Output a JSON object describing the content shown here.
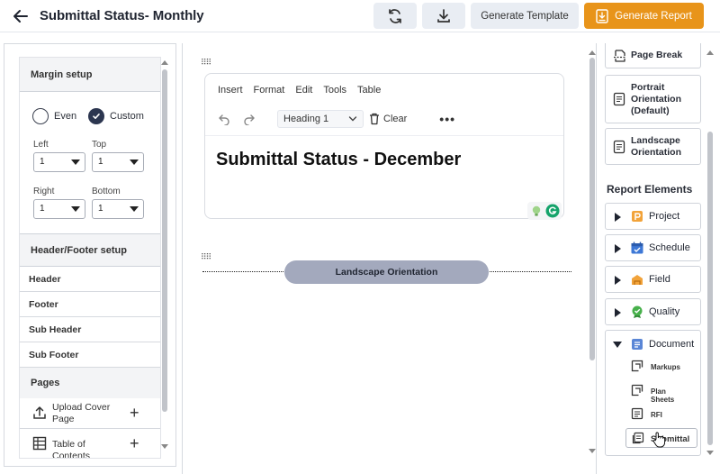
{
  "header": {
    "title": "Submittal Status- Monthly",
    "generate_template": "Generate Template",
    "generate_report": "Generate Report"
  },
  "left_panel": {
    "margin_setup": "Margin setup",
    "even": "Even",
    "custom": "Custom",
    "left_label": "Left",
    "top_label": "Top",
    "right_label": "Right",
    "bottom_label": "Bottom",
    "left_value": "1",
    "top_value": "1",
    "right_value": "1",
    "bottom_value": "1",
    "header_footer_setup": "Header/Footer setup",
    "header": "Header",
    "footer": "Footer",
    "sub_header": "Sub Header",
    "sub_footer": "Sub Footer",
    "pages": "Pages",
    "upload_cover_page": "Upload Cover Page",
    "table_of_contents": "Table of Contents"
  },
  "editor": {
    "menu": [
      "Insert",
      "Format",
      "Edit",
      "Tools",
      "Table"
    ],
    "heading_select": "Heading 1",
    "clear": "Clear",
    "more": "•••",
    "doc_title": "Submittal Status - December",
    "orientation_label": "Landscape Orientation"
  },
  "right_panel": {
    "page_break": "Page Break",
    "portrait": "Portrait Orientation (Default)",
    "landscape": "Landscape Orientation",
    "report_elements": "Report Elements",
    "elements": [
      "Project",
      "Schedule",
      "Field",
      "Quality",
      "Document"
    ],
    "document_items": [
      "Markups",
      "Plan Sheets",
      "RFI",
      "Submittal"
    ]
  },
  "colors": {
    "accent_orange": "#e8941a",
    "pill": "#a3a9bd",
    "check": "#2c3650"
  }
}
